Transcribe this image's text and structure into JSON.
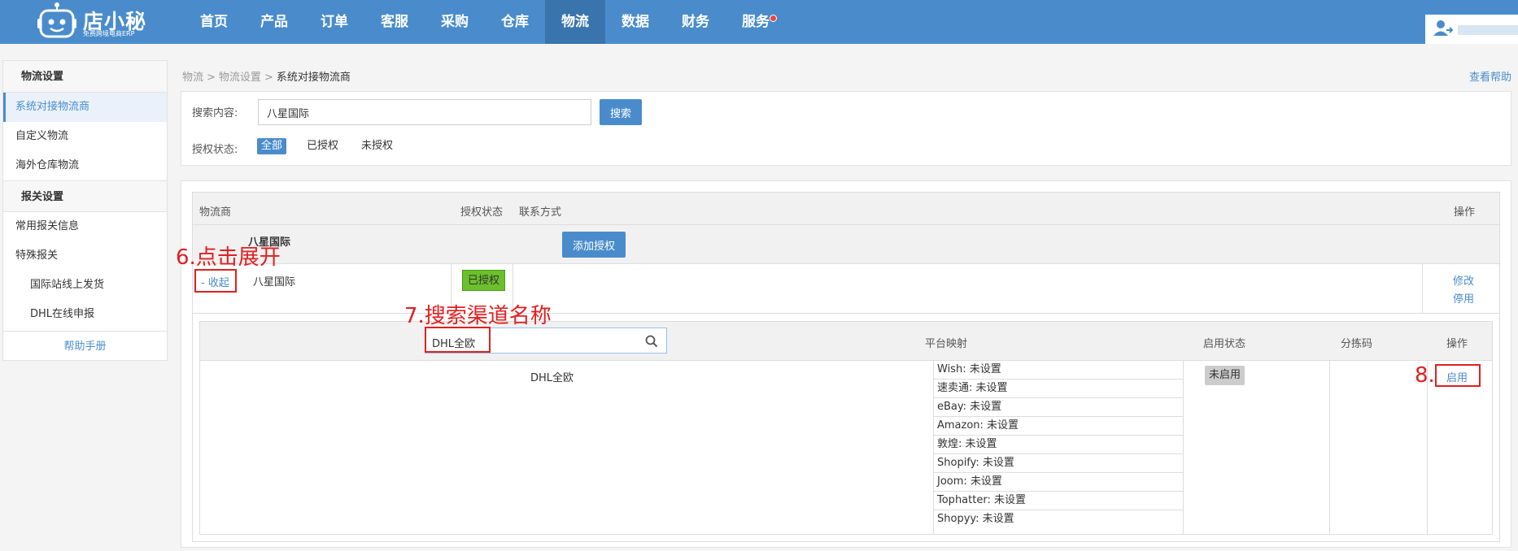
{
  "header": {
    "logo_name": "店小秘",
    "logo_slogan": "免费跨境电商ERP",
    "nav": [
      {
        "label": "首页"
      },
      {
        "label": "产品"
      },
      {
        "label": "订单"
      },
      {
        "label": "客服"
      },
      {
        "label": "采购"
      },
      {
        "label": "仓库"
      },
      {
        "label": "物流"
      },
      {
        "label": "数据"
      },
      {
        "label": "财务"
      },
      {
        "label": "服务"
      }
    ],
    "active_nav": "物流"
  },
  "sidebar": {
    "section1": "物流设置",
    "items1": [
      "系统对接物流商",
      "自定义物流",
      "海外仓库物流"
    ],
    "section2": "报关设置",
    "items2": [
      "常用报关信息",
      "特殊报关"
    ],
    "sub_items": [
      "国际站线上发货",
      "DHL在线申报"
    ],
    "help": "帮助手册"
  },
  "breadcrumb": {
    "level1": "物流",
    "level2": "物流设置",
    "current": "系统对接物流商",
    "separator": ">"
  },
  "help_link": "查看帮助",
  "search": {
    "label": "搜索内容:",
    "value": "八星国际",
    "button": "搜索",
    "auth_label": "授权状态:",
    "filters": [
      "全部",
      "已授权",
      "未授权"
    ]
  },
  "grid": {
    "headers": {
      "carrier": "物流商",
      "auth_status": "授权状态",
      "contact": "联系方式",
      "operation": "操作"
    },
    "group_name": "八星国际",
    "add_auth_button": "添加授权",
    "row": {
      "collapse": "- 收起",
      "carrier": "八星国际",
      "auth_status": "已授权",
      "edit": "修改",
      "disable": "停用"
    }
  },
  "channels": {
    "search_value": "DHL全欧",
    "headers": {
      "mapping": "平台映射",
      "enable_status": "启用状态",
      "sort_code": "分拣码",
      "operation": "操作"
    },
    "row": {
      "name": "DHL全欧",
      "mappings": [
        "Wish: 未设置",
        "速卖通: 未设置",
        "eBay: 未设置",
        "Amazon: 未设置",
        "敦煌: 未设置",
        "Shopify: 未设置",
        "Joom: 未设置",
        "Tophatter: 未设置",
        "Shopyy: 未设置"
      ],
      "status": "未启用",
      "enable": "启用"
    }
  },
  "annotations": {
    "step6": "6.点击展开",
    "step7": "7.搜索渠道名称",
    "step8": "8."
  },
  "colors": {
    "primary": "#4a8ccb",
    "nav_active": "#3a74ac",
    "authorized_green": "#6cc02b",
    "annotation_red": "#e02020"
  }
}
